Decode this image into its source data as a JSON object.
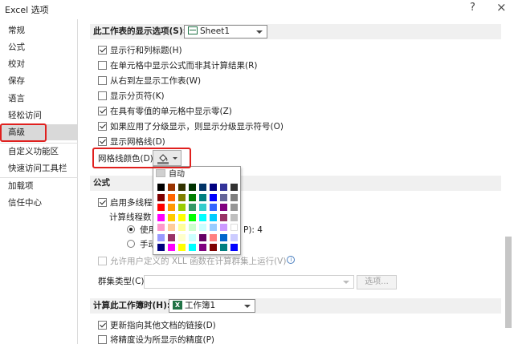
{
  "window": {
    "title": "Excel 选项",
    "help_label": "?",
    "close_label": "×"
  },
  "sidebar": {
    "items": [
      {
        "label": "常规"
      },
      {
        "label": "公式"
      },
      {
        "label": "校对"
      },
      {
        "label": "保存"
      },
      {
        "label": "语言"
      },
      {
        "label": "轻松访问"
      },
      {
        "label": "高级"
      },
      {
        "label": "自定义功能区"
      },
      {
        "label": "快速访问工具栏"
      },
      {
        "label": "加载项"
      },
      {
        "label": "信任中心"
      }
    ],
    "selected": "高级"
  },
  "sheet_section": {
    "title": "此工作表的显示选项(S):",
    "sheet_value": "Sheet1",
    "options": [
      {
        "label": "显示行和列标题(H)",
        "checked": true
      },
      {
        "label": "在单元格中显示公式而非其计算结果(R)",
        "checked": false
      },
      {
        "label": "从右到左显示工作表(W)",
        "checked": false
      },
      {
        "label": "显示分页符(K)",
        "checked": false
      },
      {
        "label": "在具有零值的单元格中显示零(Z)",
        "checked": true
      },
      {
        "label": "如果应用了分级显示，则显示分级显示符号(O)",
        "checked": true
      },
      {
        "label": "显示网格线(D)",
        "checked": true
      }
    ],
    "gridline_color_label": "网格线颜色(D)"
  },
  "color_popup": {
    "auto_label": "自动",
    "rows": [
      [
        "#000000",
        "#993300",
        "#333300",
        "#003300",
        "#003366",
        "#000080",
        "#333399",
        "#333333"
      ],
      [
        "#800000",
        "#ff6600",
        "#808000",
        "#008000",
        "#008080",
        "#0000ff",
        "#666699",
        "#808080"
      ],
      [
        "#ff0000",
        "#ff9900",
        "#99cc00",
        "#339966",
        "#33cccc",
        "#3366ff",
        "#800080",
        "#969696"
      ],
      [
        "#ff00ff",
        "#ffcc00",
        "#ffff00",
        "#00ff00",
        "#00ffff",
        "#00ccff",
        "#993366",
        "#c0c0c0"
      ],
      [
        "#ff99cc",
        "#ffcc99",
        "#ffff99",
        "#ccffcc",
        "#ccffff",
        "#99ccff",
        "#cc99ff",
        "#ffffff"
      ],
      [
        "#9999ff",
        "#993366",
        "#ffffcc",
        "#ccffff",
        "#660066",
        "#ff8080",
        "#0066cc",
        "#ccccff"
      ],
      [
        "#000080",
        "#ff00ff",
        "#ffff00",
        "#00ffff",
        "#800080",
        "#800000",
        "#008080",
        "#0000ff"
      ]
    ]
  },
  "formula_section": {
    "title": "公式",
    "multithread_label": "启用多线程计",
    "multithread_checked": true,
    "calc_threads_label": "计算线程数",
    "use_all_label": "使用",
    "use_all_suffix": "P):  4",
    "manual_label": "手动",
    "xll_label": "允许用户定义的 XLL 函数在计算群集上运行(V)",
    "cluster_type_label": "群集类型(C):",
    "options_button": "选项..."
  },
  "workbook_section": {
    "title": "计算此工作簿时(H):",
    "workbook_value": "工作簿1",
    "options": [
      {
        "label": "更新指向其他文档的链接(D)",
        "checked": true
      },
      {
        "label": "将精度设为所显示的精度(P)",
        "checked": false
      }
    ]
  },
  "colors": {
    "highlight_red": "#e0201e",
    "selected_bg": "#d9d9d9",
    "excel_green": "#217346"
  }
}
